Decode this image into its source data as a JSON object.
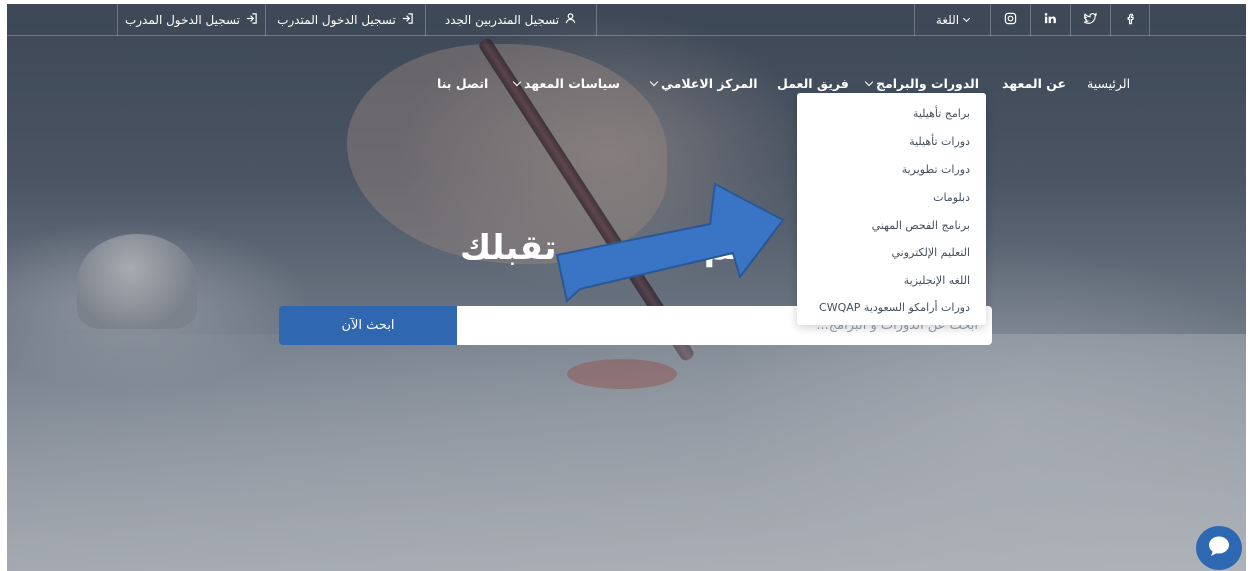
{
  "topbar": {
    "trainer_login": "تسجيل الدخول المدرب",
    "trainee_login": "تسجيل الدخول المتدرب",
    "register_trainees": "تسجيل المتدربين الجدد",
    "language": "اللغة"
  },
  "icons": {
    "login": "login-icon",
    "user": "user-icon",
    "instagram": "instagram-icon",
    "linkedin": "linkedin-icon",
    "twitter": "twitter-icon",
    "facebook": "facebook-icon",
    "chat": "chat-icon"
  },
  "nav": {
    "home": "الرئيسية",
    "about": "عن المعهد",
    "courses": "الدورات والبرامج",
    "team": "فريق العمل",
    "media": "المركز الاعلامي",
    "policies": "سياسات المعهد",
    "contact": "اتصل بنا"
  },
  "dropdown": {
    "items": [
      "برامج تأهيلية",
      "دورات تأهيلية",
      "دورات تطويرية",
      "دبلومات",
      "برنامج الفحص المهني",
      "التعليم الإلكتروني",
      "اللغه الإنجليزية",
      "دورات أرامكو السعودية CWQAP"
    ]
  },
  "hero": {
    "title_part_a": "تقبلك",
    "title_part_b": "قم"
  },
  "search": {
    "placeholder": "ابحث عن الدورات و البرامج...",
    "button_label": "ابحث الآن"
  },
  "colors": {
    "accent": "#2f67b0",
    "arrow": "#3a74c4",
    "chat": "#2e68b3"
  }
}
